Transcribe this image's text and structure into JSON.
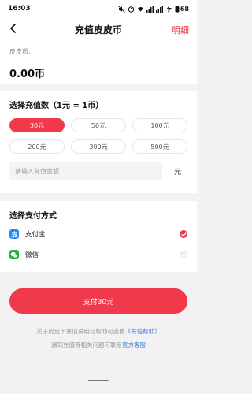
{
  "status_bar": {
    "time": "16:03",
    "battery": "68"
  },
  "header": {
    "title": "充值皮皮币",
    "action": "明细"
  },
  "balance": {
    "label": "皮皮币：",
    "value": "0.00币"
  },
  "recharge": {
    "title": "选择充值数（1元 = 1币）",
    "amounts": [
      "30元",
      "50元",
      "100元",
      "200元",
      "300元",
      "500元"
    ],
    "selected": "30元",
    "input_placeholder": "请输入充值金额",
    "unit": "元"
  },
  "payment": {
    "title": "选择支付方式",
    "methods": [
      {
        "label": "支付宝",
        "selected": true
      },
      {
        "label": "微信",
        "selected": false
      }
    ]
  },
  "pay_button": {
    "label": "支付30元"
  },
  "info": {
    "line1_prefix": "关于皮皮币充值说明与帮助可查看",
    "line1_link": "《充值帮助》",
    "line2_prefix": "遇到充值等相关问题可联系",
    "line2_link": "官方客服"
  },
  "colors": {
    "accent": "#f03a4b",
    "link": "#3f7fd8",
    "alipay": "#1a8cff",
    "wechat": "#2aae3c"
  }
}
